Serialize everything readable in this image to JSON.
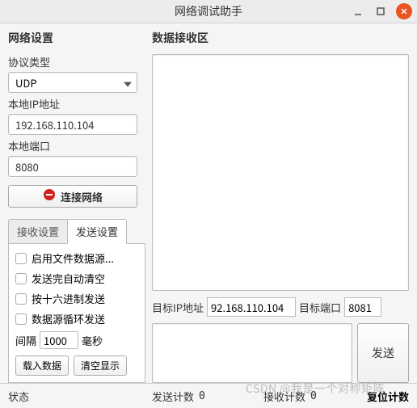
{
  "window": {
    "title": "网络调试助手"
  },
  "network": {
    "section_title": "网络设置",
    "protocol_label": "协议类型",
    "protocol_value": "UDP",
    "local_ip_label": "本地IP地址",
    "local_ip_value": "192.168.110.104",
    "local_port_label": "本地端口",
    "local_port_value": "8080",
    "connect_label": "连接网络"
  },
  "tabs": {
    "recv": "接收设置",
    "send": "发送设置"
  },
  "send_settings": {
    "opt1": "启用文件数据源...",
    "opt2": "发送完自动清空",
    "opt3": "按十六进制发送",
    "opt4": "数据源循环发送",
    "interval_prefix": "间隔",
    "interval_value": "1000",
    "interval_suffix": "毫秒",
    "load_btn": "载入数据",
    "clear_btn": "清空显示"
  },
  "recv_area": {
    "title": "数据接收区"
  },
  "target": {
    "ip_label": "目标IP地址",
    "ip_value": "92.168.110.104",
    "port_label": "目标端口",
    "port_value": "8081"
  },
  "send": {
    "btn": "发送"
  },
  "status": {
    "state_label": "状态",
    "send_count_label": "发送计数",
    "send_count_value": "0",
    "recv_count_label": "接收计数",
    "recv_count_value": "0",
    "reset_label": "复位计数"
  },
  "watermark": "CSDN @我是一个对称矩阵"
}
